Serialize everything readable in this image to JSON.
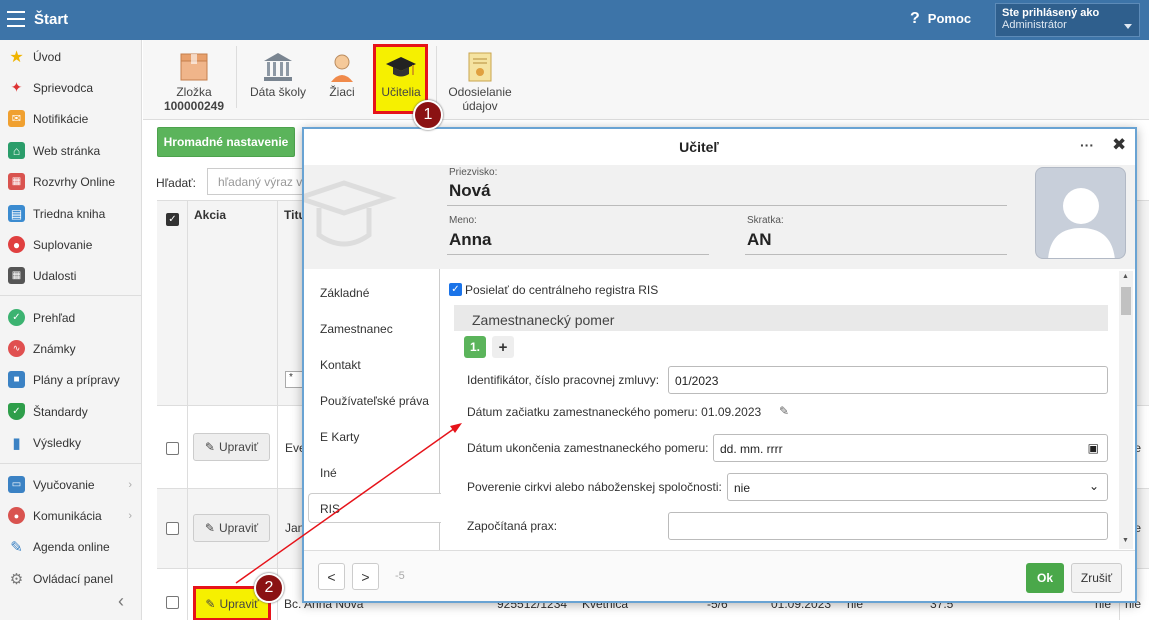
{
  "app": {
    "title": "Štart"
  },
  "header": {
    "help_label": "Pomoc",
    "user_line1": "Ste prihlásený ako",
    "user_line2": "Administrátor"
  },
  "sidebar": {
    "items": [
      {
        "label": "Úvod",
        "icon": "star-icon"
      },
      {
        "label": "Sprievodca",
        "icon": "magic-wand-icon"
      },
      {
        "label": "Notifikácie",
        "icon": "envelope-icon"
      },
      {
        "label": "Web stránka",
        "icon": "home-icon"
      },
      {
        "label": "Rozvrhy Online",
        "icon": "calendar-grid-icon"
      },
      {
        "label": "Triedna kniha",
        "icon": "book-icon"
      },
      {
        "label": "Suplovanie",
        "icon": "person-icon"
      },
      {
        "label": "Udalosti",
        "icon": "calendar-icon"
      },
      {
        "label": "Prehľad",
        "icon": "check-circle-icon"
      },
      {
        "label": "Známky",
        "icon": "chart-icon"
      },
      {
        "label": "Plány a prípravy",
        "icon": "briefcase-icon"
      },
      {
        "label": "Štandardy",
        "icon": "shield-icon"
      },
      {
        "label": "Výsledky",
        "icon": "bar-chart-icon"
      },
      {
        "label": "Vyučovanie",
        "icon": "open-book-icon"
      },
      {
        "label": "Komunikácia",
        "icon": "chat-icon"
      },
      {
        "label": "Agenda online",
        "icon": "pen-icon"
      },
      {
        "label": "Ovládací panel",
        "icon": "gear-icon"
      }
    ]
  },
  "toolbar": {
    "folder_label": "Zložka",
    "folder_number": "100000249",
    "school_label": "Dáta školy",
    "students_label": "Žiaci",
    "teachers_label": "Učitelia",
    "send_label_1": "Odosielanie",
    "send_label_2": "údajov"
  },
  "badges": {
    "b1": "1",
    "b2": "2"
  },
  "list": {
    "bulk_button": "Hromadné nastavenie",
    "search_label": "Hľadať:",
    "search_placeholder": "hľadaný výraz v",
    "col_action": "Akcia",
    "col_title_partial": "Titu",
    "filter_value": "*",
    "edit_label": "Upraviť",
    "rows": [
      {
        "name_partial": "Eve",
        "right": "nie"
      },
      {
        "name_partial": "Jan",
        "right": "nie"
      },
      {
        "name": "Bc. Anna Nová",
        "c2": "925512/1234",
        "c3": "Kvetnica",
        "c4": "-5/6",
        "c5": "01.09.2023",
        "c6": "nie",
        "c7": "37.5",
        "c8": "nie",
        "c9": "nie"
      }
    ]
  },
  "modal": {
    "title": "Učiteľ",
    "dots": "···",
    "close": "✖",
    "surname_label": "Priezvisko:",
    "surname": "Nová",
    "name_label": "Meno:",
    "name": "Anna",
    "abbr_label": "Skratka:",
    "abbr": "AN",
    "tabs": [
      "Základné",
      "Zamestnanec",
      "Kontakt",
      "Používateľské práva",
      "E Karty",
      "Iné",
      "RIS"
    ],
    "ris_checkbox": "Posielať do centrálneho registra RIS",
    "section": "Zamestnanecký pomer",
    "contract_number": "1.",
    "add": "+",
    "contract_id_label": "Identifikátor, číslo pracovnej zmluvy:",
    "contract_id": "01/2023",
    "start_label": "Dátum začiatku zamestnaneckého pomeru:",
    "start_value": "01.09.2023",
    "end_label": "Dátum ukončenia zamestnaneckého pomeru:",
    "end_placeholder": "dd. mm. rrrr",
    "church_label": "Poverenie cirkvi alebo náboženskej spoločnosti:",
    "church_value": "nie",
    "practice_label": "Započítaná prax:",
    "prev": "<",
    "next": ">",
    "offset": "-5",
    "ok": "Ok",
    "cancel": "Zrušiť"
  },
  "colors": {
    "topbar": "#3d74a8",
    "accent_green": "#5bb45b",
    "highlight_yellow": "#f6f000",
    "highlight_red": "#e6131a",
    "badge": "#8b1213"
  }
}
